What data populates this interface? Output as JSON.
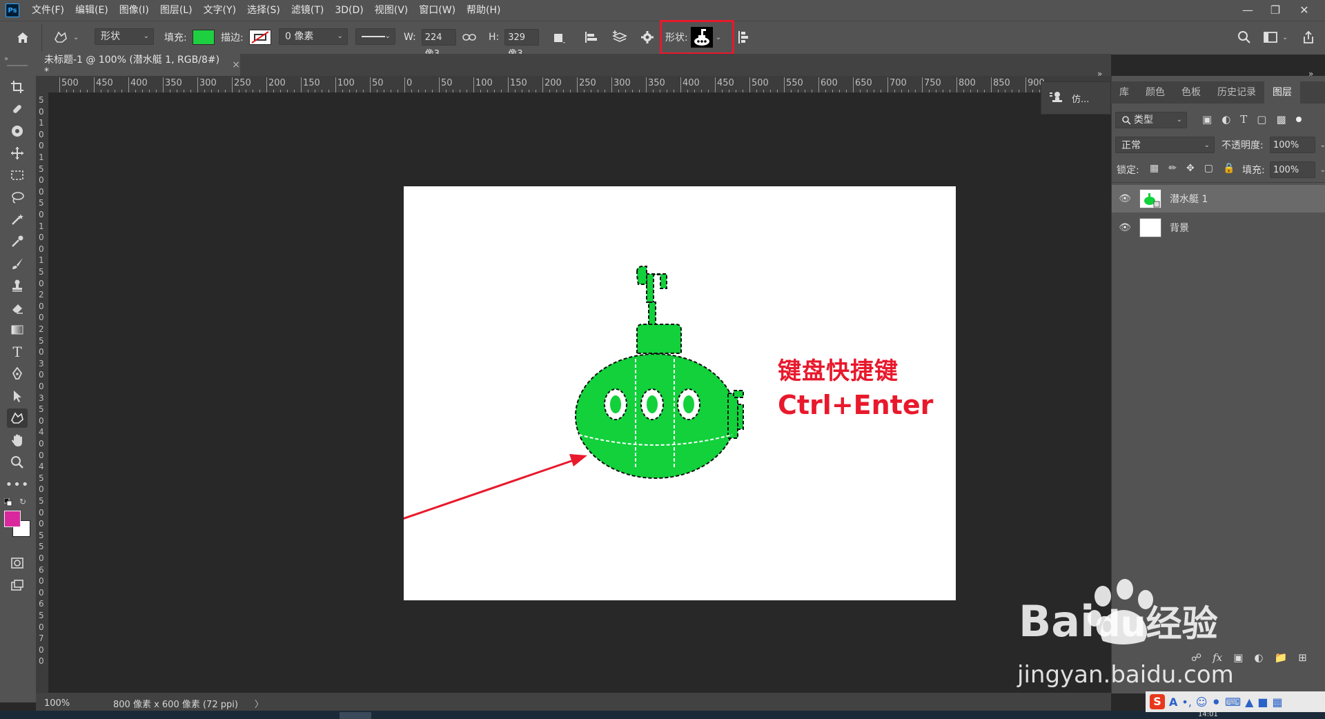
{
  "app": {
    "logo": "Ps",
    "menus": [
      "文件(F)",
      "编辑(E)",
      "图像(I)",
      "图层(L)",
      "文字(Y)",
      "选择(S)",
      "滤镜(T)",
      "3D(D)",
      "视图(V)",
      "窗口(W)",
      "帮助(H)"
    ],
    "window_controls": [
      "minimize-icon",
      "restore-icon",
      "close-icon"
    ]
  },
  "options_bar": {
    "tool_mode": "形状",
    "fill_label": "填充:",
    "fill_color": "#1ed03f",
    "stroke_label": "描边:",
    "stroke_width": "0 像素",
    "w_label": "W:",
    "w_value": "224 像3",
    "h_label": "H:",
    "h_value": "329 像3",
    "shape_label": "形状:",
    "highlight_color": "#e8192c"
  },
  "document": {
    "tab_title": "未标题-1 @ 100% (潜水艇 1, RGB/8#) *",
    "close": "×"
  },
  "rulers": {
    "horizontal_ticks": [
      "500",
      "450",
      "400",
      "350",
      "300",
      "250",
      "200",
      "150",
      "100",
      "50",
      "0",
      "50",
      "100",
      "150",
      "200",
      "250",
      "300",
      "350",
      "400",
      "450",
      "500",
      "550",
      "600",
      "650",
      "700",
      "750",
      "800",
      "850",
      "900"
    ],
    "vertical_labels": [
      "5",
      "0",
      "1",
      "0",
      "0",
      "1",
      "5",
      "0",
      "0",
      "5",
      "0",
      "1",
      "0",
      "0",
      "1",
      "5",
      "0",
      "2",
      "0",
      "0",
      "2",
      "5",
      "0",
      "3",
      "0",
      "0",
      "3",
      "5",
      "0",
      "4",
      "0",
      "0",
      "4",
      "5",
      "0",
      "5",
      "0",
      "0",
      "5",
      "5",
      "0",
      "6",
      "0",
      "0",
      "6",
      "5",
      "0",
      "7",
      "0",
      "0"
    ]
  },
  "canvas": {
    "shape_color": "#12d13b",
    "shortcut_title": "键盘快捷键",
    "shortcut_keys": "Ctrl+Enter",
    "arrow_color": "#e8192c"
  },
  "status": {
    "zoom": "100%",
    "doc_info": "800 像素 x 600 像素 (72 ppi)",
    "arrow": "〉"
  },
  "mini_panel": {
    "label": "仿..."
  },
  "panel": {
    "tabs": [
      "库",
      "颜色",
      "色板",
      "历史记录",
      "图层"
    ],
    "filter_label": "类型",
    "blend_mode": "正常",
    "opacity_label": "不透明度:",
    "opacity_value": "100%",
    "lock_label": "锁定:",
    "fill_label": "填充:",
    "fill_value": "100%",
    "layers": [
      {
        "name": "潜水艇 1",
        "visible": true
      },
      {
        "name": "背景",
        "visible": true
      }
    ]
  },
  "colors": {
    "foreground": "#d9289e",
    "background": "#ffffff"
  },
  "watermark": {
    "brand": "Bai",
    "brand_du": "du",
    "brand_cn": "经验",
    "url": "jingyan.baidu.com"
  },
  "tray": {
    "time": "14:01",
    "icons": [
      "sogou-icon",
      "input-mode-icon",
      "punctuation-icon",
      "emoji-icon",
      "mic-icon",
      "keyboard-icon",
      "skin-icon",
      "shirt-icon",
      "grid-icon"
    ]
  }
}
